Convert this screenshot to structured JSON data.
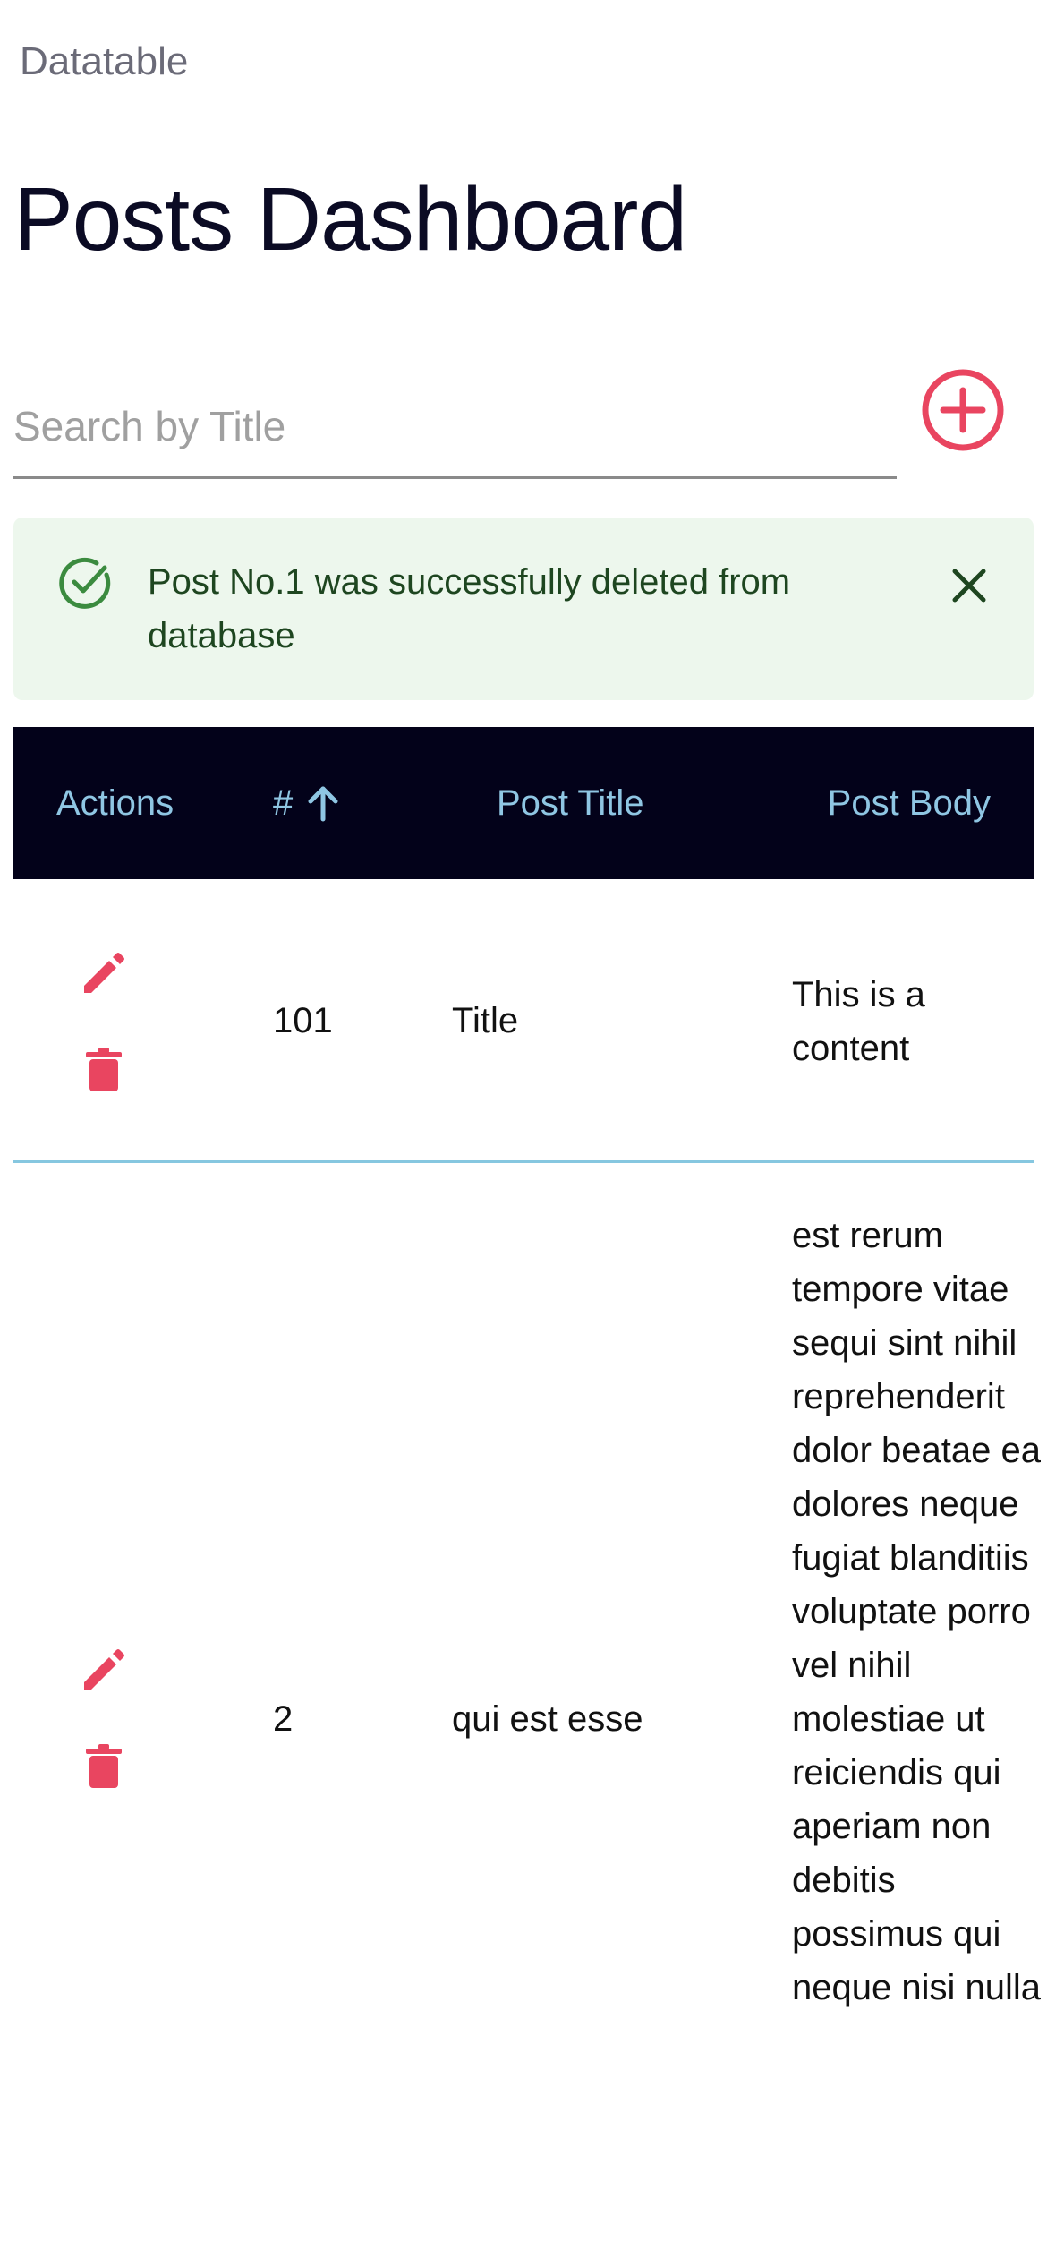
{
  "app": {
    "label": "Datatable"
  },
  "page": {
    "title": "Posts Dashboard"
  },
  "search": {
    "placeholder": "Search by Title",
    "value": ""
  },
  "alert": {
    "message": "Post No.1 was successfully deleted from database",
    "icon": "check-circle-icon",
    "background": "#edf7ed",
    "text_color": "#1e4620"
  },
  "table": {
    "headers": {
      "actions": "Actions",
      "id": "#",
      "title": "Post Title",
      "body": "Post Body"
    },
    "sort": {
      "column": "id",
      "direction": "ascending",
      "icon": "arrow-up-icon"
    },
    "rows": [
      {
        "id": "101",
        "title": "Title",
        "body": "This is a content"
      },
      {
        "id": "2",
        "title": "qui est esse",
        "body": "est rerum tempore vitae sequi sint nihil reprehenderit dolor beatae ea dolores neque fugiat blanditiis voluptate porro vel nihil molestiae ut reiciendis qui aperiam non debitis possimus qui neque nisi nulla"
      }
    ]
  },
  "colors": {
    "accent": "#e94560",
    "header_bg": "#03021a",
    "header_text": "#8fc6e3",
    "divider": "#86c7e0"
  }
}
